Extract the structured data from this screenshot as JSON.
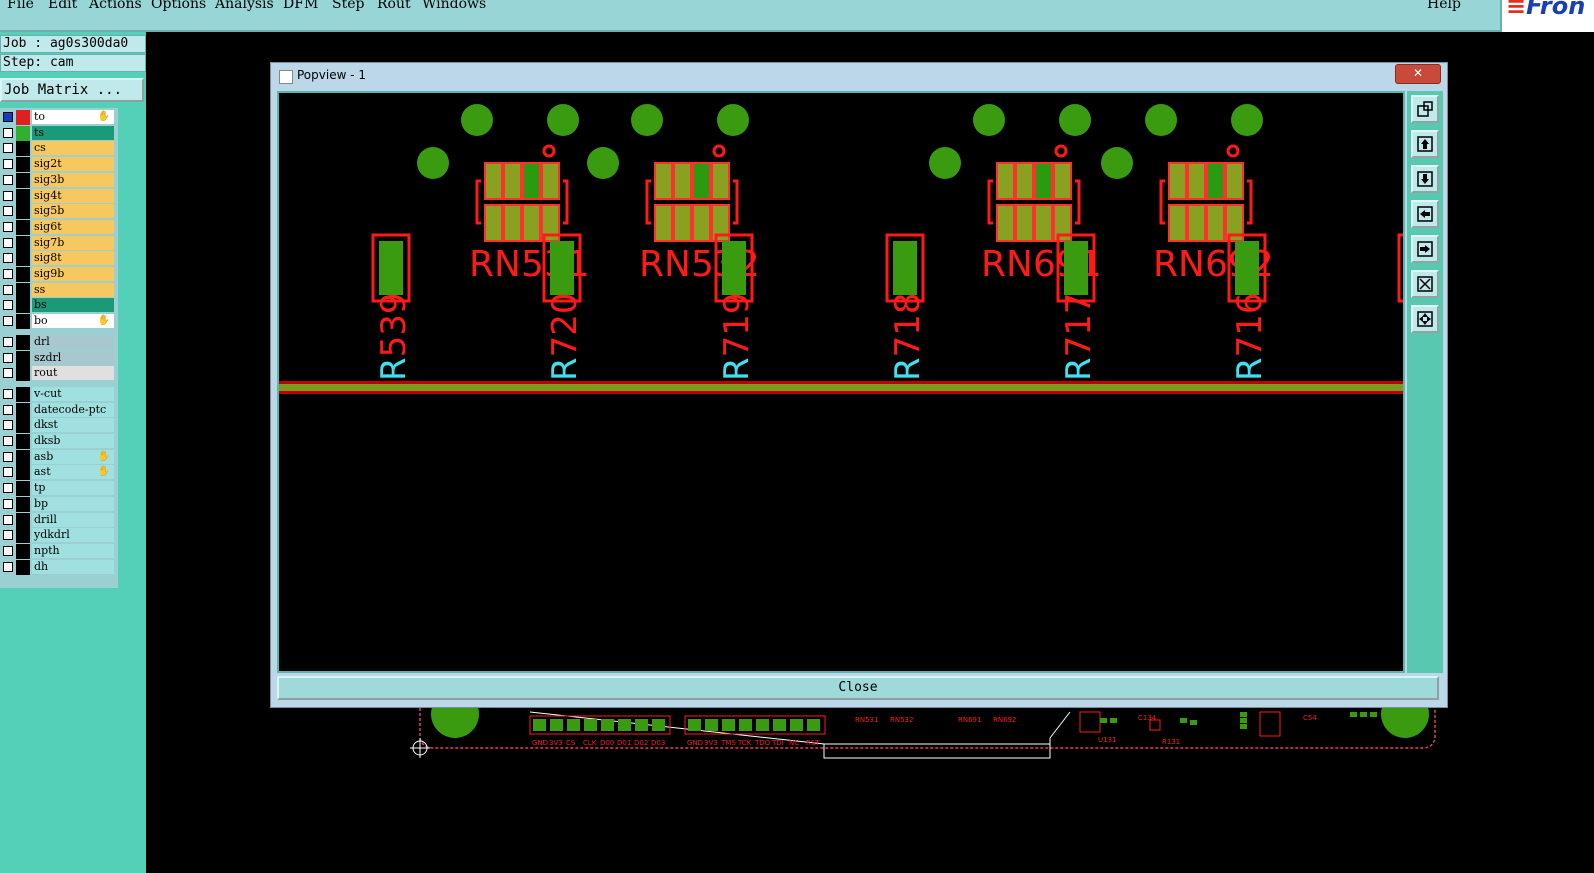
{
  "menubar": {
    "items": [
      "File",
      "Edit",
      "Actions",
      "Options",
      "Analysis",
      "DFM",
      "Step",
      "Rout",
      "Windows"
    ],
    "help": "Help",
    "brand": "Fron"
  },
  "leftpanel": {
    "job": "Job : ag0s300da0",
    "step": "Step: cam",
    "job_matrix": "Job Matrix ..."
  },
  "layers": [
    {
      "name": "to",
      "color": "#ffffff",
      "hand": true
    },
    {
      "name": "ts",
      "color": "#1a9a78",
      "hand": false
    },
    {
      "name": "cs",
      "color": "#f8c860",
      "hand": false
    },
    {
      "name": "sig2t",
      "color": "#f8c860",
      "hand": false
    },
    {
      "name": "sig3b",
      "color": "#f8c860",
      "hand": false
    },
    {
      "name": "sig4t",
      "color": "#f8c860",
      "hand": false
    },
    {
      "name": "sig5b",
      "color": "#f8c860",
      "hand": false
    },
    {
      "name": "sig6t",
      "color": "#f8c860",
      "hand": false
    },
    {
      "name": "sig7b",
      "color": "#f8c860",
      "hand": false
    },
    {
      "name": "sig8t",
      "color": "#f8c860",
      "hand": false
    },
    {
      "name": "sig9b",
      "color": "#f8c860",
      "hand": false
    },
    {
      "name": "ss",
      "color": "#f8c860",
      "hand": false
    },
    {
      "name": "bs",
      "color": "#1a9a78",
      "hand": false
    },
    {
      "name": "bo",
      "color": "#ffffff",
      "hand": true
    },
    {
      "name": "drl",
      "color": "#a8c8d0",
      "hand": false
    },
    {
      "name": "szdrl",
      "color": "#a8c8d0",
      "hand": false
    },
    {
      "name": "rout",
      "color": "#e0e0e0",
      "hand": false
    },
    {
      "name": "v-cut",
      "color": "#a0e0e0",
      "hand": false
    },
    {
      "name": "datecode-ptc",
      "color": "#a0e0e0",
      "hand": false
    },
    {
      "name": "dkst",
      "color": "#a0e0e0",
      "hand": false
    },
    {
      "name": "dksb",
      "color": "#a0e0e0",
      "hand": false
    },
    {
      "name": "asb",
      "color": "#a0e0e0",
      "hand": true
    },
    {
      "name": "ast",
      "color": "#a0e0e0",
      "hand": true
    },
    {
      "name": "tp",
      "color": "#a0e0e0",
      "hand": false
    },
    {
      "name": "bp",
      "color": "#a0e0e0",
      "hand": false
    },
    {
      "name": "drill",
      "color": "#a0e0e0",
      "hand": false
    },
    {
      "name": "ydkdrl",
      "color": "#a0e0e0",
      "hand": false
    },
    {
      "name": "npth",
      "color": "#a0e0e0",
      "hand": false
    },
    {
      "name": "dh",
      "color": "#a0e0e0",
      "hand": false
    }
  ],
  "popview": {
    "title": "Popview - 1",
    "close_x": "✕",
    "close_button": "Close"
  },
  "components": {
    "rn": [
      "RN531",
      "RN532",
      "RN691",
      "RN692"
    ],
    "r": [
      "R539",
      "R720",
      "R719",
      "R718",
      "R717",
      "R716"
    ]
  },
  "board": {
    "connector1": [
      "GND",
      "3V3",
      "CS",
      "CLK",
      "D00",
      "D01",
      "D02",
      "D03"
    ],
    "connector2": [
      "GND",
      "3V3",
      "TMS",
      "TCK",
      "TDO",
      "TDI",
      "NC",
      "RST"
    ],
    "small_labels": [
      "RN531",
      "RN532",
      "RN691",
      "RN692",
      "U131",
      "C134",
      "R131",
      "C54"
    ]
  },
  "colors": {
    "menubar": "#97d5d6",
    "panel": "#55d0b8",
    "pad_green": "#3a9a10",
    "outline_red": "#ff1a1a",
    "label_cyan": "#40e0f0"
  }
}
